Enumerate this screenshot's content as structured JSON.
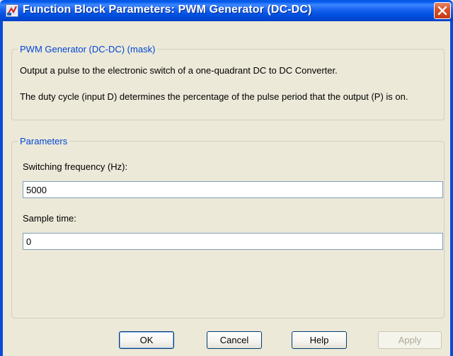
{
  "window": {
    "title": "Function Block Parameters: PWM Generator (DC-DC)"
  },
  "mask_group": {
    "legend": "PWM Generator (DC-DC) (mask)",
    "description_1": "Output a pulse to the electronic switch of a one-quadrant DC to DC Converter.",
    "description_2": "The duty cycle (input D) determines the percentage of the pulse period that the output (P) is on."
  },
  "parameters_group": {
    "legend": "Parameters",
    "switching_frequency": {
      "label": "Switching frequency (Hz):",
      "value": "5000"
    },
    "sample_time": {
      "label": "Sample time:",
      "value": "0"
    }
  },
  "buttons": {
    "ok": "OK",
    "cancel": "Cancel",
    "help": "Help",
    "apply": "Apply"
  },
  "icons": {
    "title_icon": "simulink-block-icon",
    "close_icon": "close-icon"
  },
  "colors": {
    "titlebar": "#0058ee",
    "legend_text": "#0046d5",
    "close_button": "#d8522b",
    "dialog_background": "#ece9d8"
  }
}
